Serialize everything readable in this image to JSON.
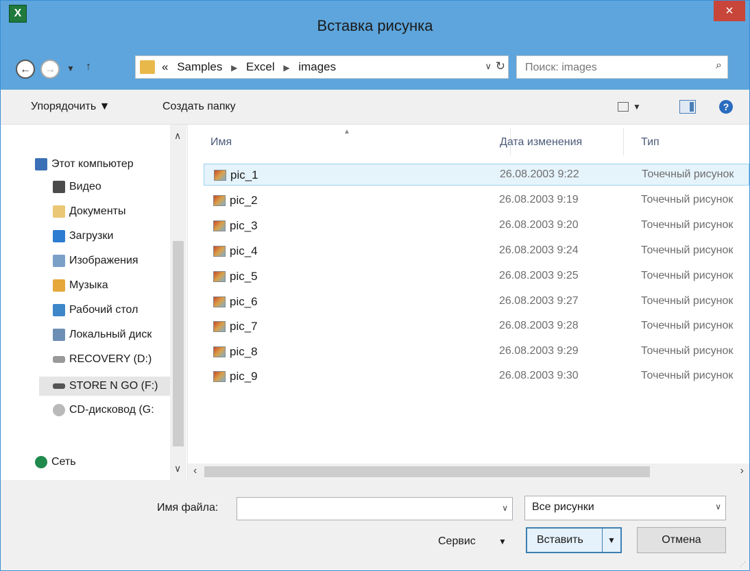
{
  "window": {
    "title": "Вставка рисунка",
    "app_icon": "X",
    "close_label": "×"
  },
  "address": {
    "crumbs": [
      "«",
      "Samples",
      "Excel",
      "images"
    ]
  },
  "search": {
    "placeholder": "Поиск: images"
  },
  "toolbar": {
    "organize_label": "Упорядочить ▼",
    "new_folder_label": "Создать папку"
  },
  "nav": {
    "items": [
      {
        "label": "Этот компьютер",
        "icon": "computer-icon"
      },
      {
        "label": "Видео",
        "icon": "video-folder-icon"
      },
      {
        "label": "Документы",
        "icon": "documents-folder-icon"
      },
      {
        "label": "Загрузки",
        "icon": "downloads-folder-icon"
      },
      {
        "label": "Изображения",
        "icon": "pictures-folder-icon"
      },
      {
        "label": "Музыка",
        "icon": "music-folder-icon"
      },
      {
        "label": "Рабочий стол",
        "icon": "desktop-folder-icon"
      },
      {
        "label": "Локальный диск",
        "icon": "local-disk-icon"
      },
      {
        "label": "RECOVERY (D:)",
        "icon": "drive-icon"
      },
      {
        "label": "STORE N GO (F:)",
        "icon": "drive-icon"
      },
      {
        "label": "CD-дисковод (G:",
        "icon": "cd-drive-icon"
      },
      {
        "label": "Сеть",
        "icon": "network-icon"
      }
    ]
  },
  "columns": {
    "name": "Имя",
    "date": "Дата изменения",
    "type": "Тип"
  },
  "files": [
    {
      "name": "pic_1",
      "date": "26.08.2003 9:22",
      "type": "Точечный рисунок"
    },
    {
      "name": "pic_2",
      "date": "26.08.2003 9:19",
      "type": "Точечный рисунок"
    },
    {
      "name": "pic_3",
      "date": "26.08.2003 9:20",
      "type": "Точечный рисунок"
    },
    {
      "name": "pic_4",
      "date": "26.08.2003 9:24",
      "type": "Точечный рисунок"
    },
    {
      "name": "pic_5",
      "date": "26.08.2003 9:25",
      "type": "Точечный рисунок"
    },
    {
      "name": "pic_6",
      "date": "26.08.2003 9:27",
      "type": "Точечный рисунок"
    },
    {
      "name": "pic_7",
      "date": "26.08.2003 9:28",
      "type": "Точечный рисунок"
    },
    {
      "name": "pic_8",
      "date": "26.08.2003 9:29",
      "type": "Точечный рисунок"
    },
    {
      "name": "pic_9",
      "date": "26.08.2003 9:30",
      "type": "Точечный рисунок"
    }
  ],
  "bottom": {
    "filename_label": "Имя файла:",
    "filename_value": "",
    "filter_value": "Все рисунки",
    "tools_label": "Сервис",
    "insert_label": "Вставить",
    "cancel_label": "Отмена"
  }
}
